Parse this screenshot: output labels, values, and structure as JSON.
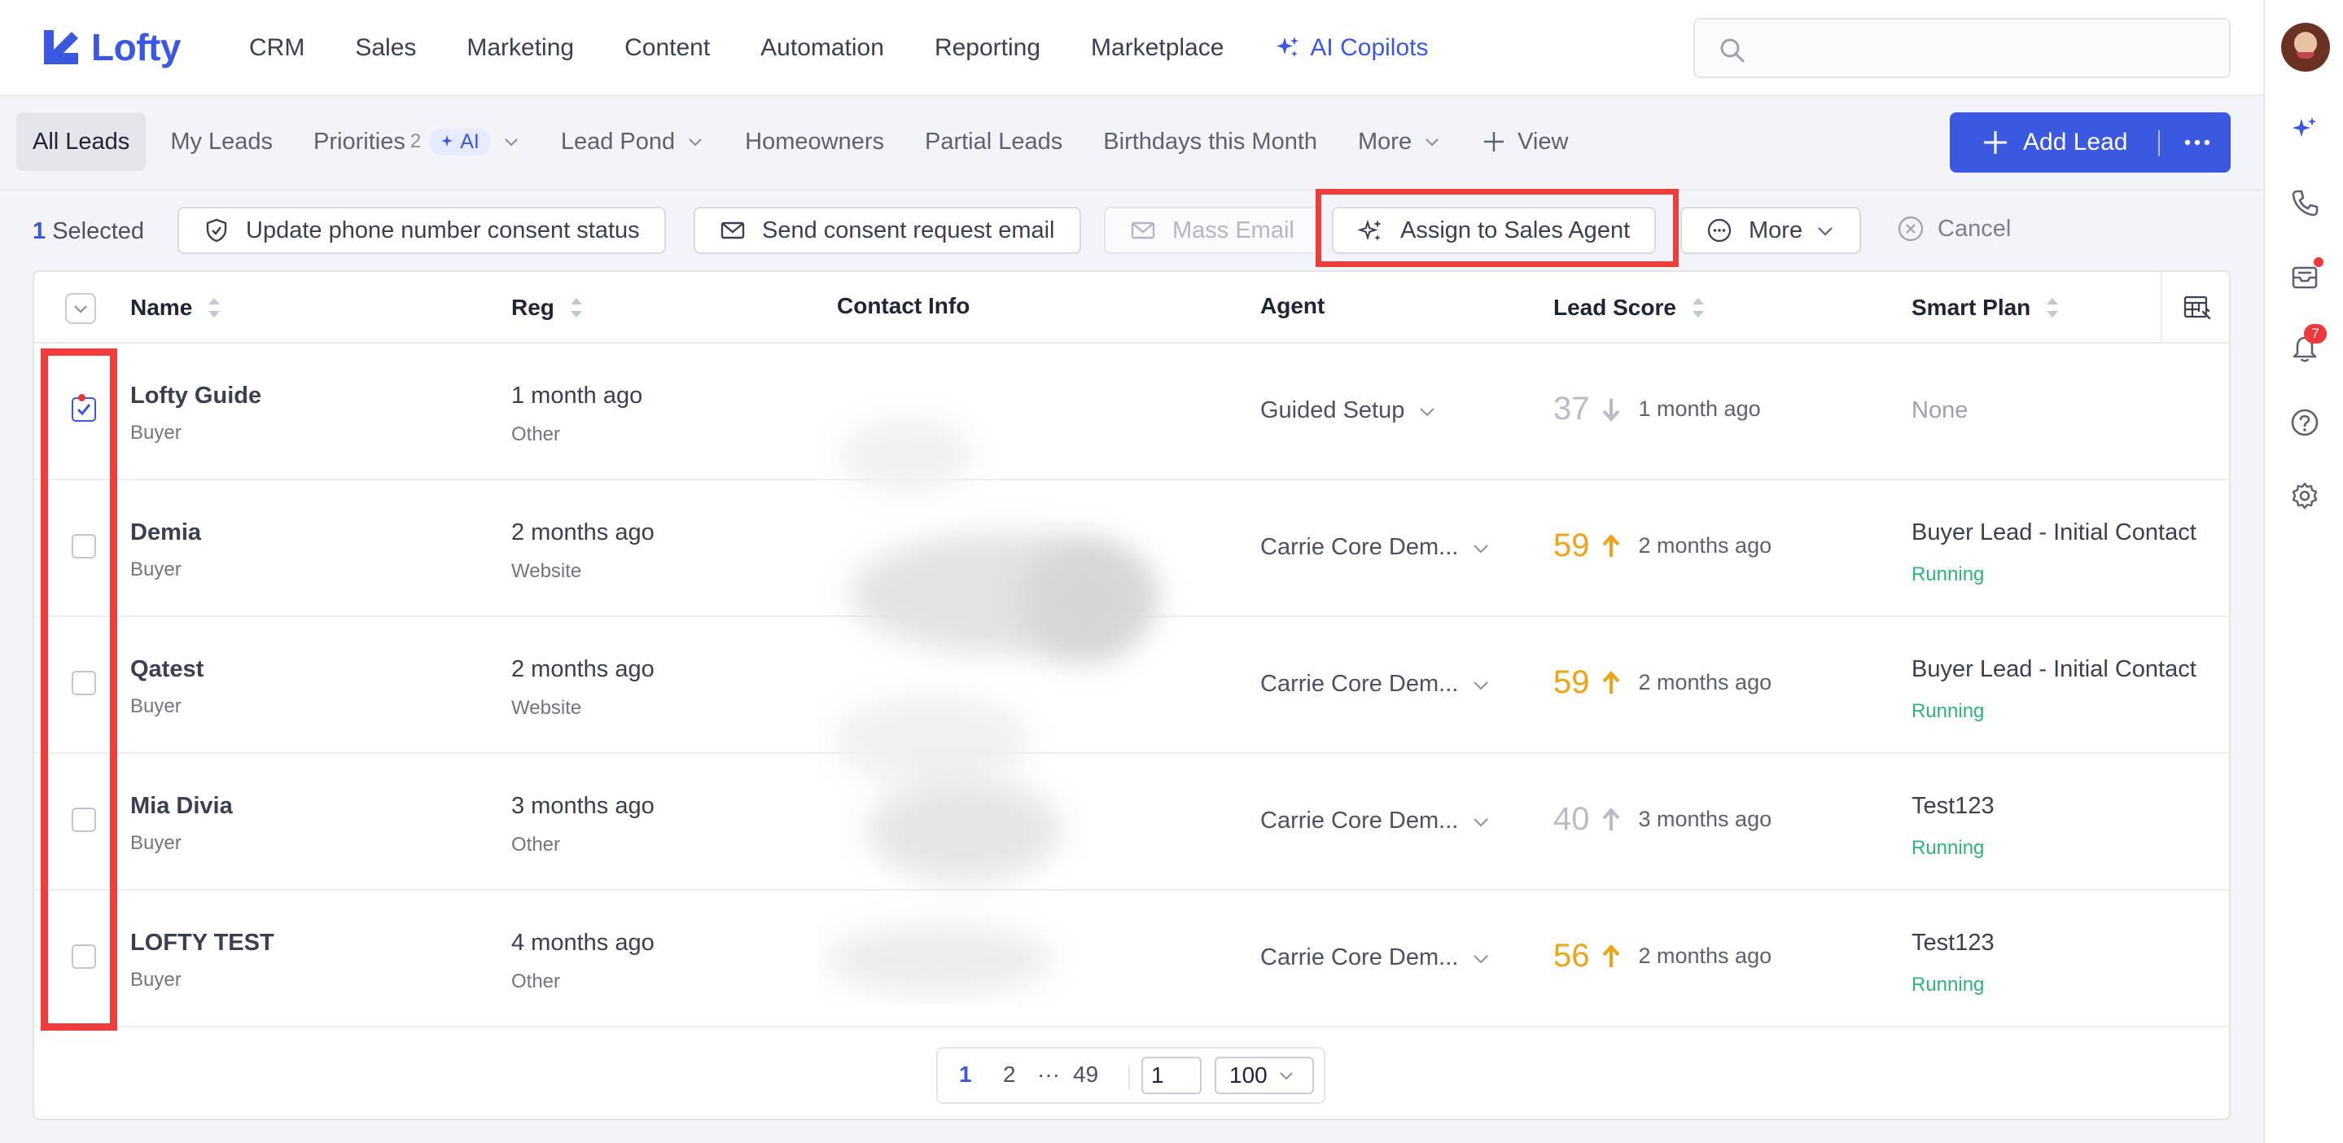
{
  "brand": {
    "name": "Lofty"
  },
  "nav": {
    "items": [
      "CRM",
      "Sales",
      "Marketing",
      "Content",
      "Automation",
      "Reporting",
      "Marketplace"
    ],
    "ai_copilots": "AI Copilots"
  },
  "search": {
    "placeholder": ""
  },
  "tabs": {
    "all_leads": "All Leads",
    "my_leads": "My Leads",
    "priorities": "Priorities",
    "priorities_count": "2",
    "ai_pill": "AI",
    "lead_pond": "Lead Pond",
    "homeowners": "Homeowners",
    "partial_leads": "Partial Leads",
    "birthdays": "Birthdays this Month",
    "more": "More",
    "view": "View"
  },
  "add_lead": {
    "label": "Add Lead"
  },
  "actions": {
    "selected_count": "1",
    "selected_label": "Selected",
    "update_consent": "Update phone number consent status",
    "send_consent": "Send consent request email",
    "mass_email": "Mass Email",
    "assign_agent": "Assign to Sales Agent",
    "more": "More",
    "cancel": "Cancel"
  },
  "table": {
    "headers": {
      "name": "Name",
      "reg": "Reg",
      "contact": "Contact Info",
      "agent": "Agent",
      "lead_score": "Lead Score",
      "smart_plan": "Smart Plan"
    },
    "rows": [
      {
        "name": "Lofty Guide",
        "type": "Buyer",
        "reg": "1 month ago",
        "source": "Other",
        "agent": "Guided Setup",
        "score": "37",
        "score_trend": "down",
        "score_color": "#b9bcc7",
        "score_when": "1 month ago",
        "plan": "None",
        "plan_status": "",
        "checked": true
      },
      {
        "name": "Demia",
        "type": "Buyer",
        "reg": "2 months ago",
        "source": "Website",
        "agent": "Carrie Core Dem...",
        "score": "59",
        "score_trend": "up",
        "score_color": "#f0a316",
        "score_when": "2 months ago",
        "plan": "Buyer Lead - Initial Contact",
        "plan_status": "Running",
        "checked": false
      },
      {
        "name": "Qatest",
        "type": "Buyer",
        "reg": "2 months ago",
        "source": "Website",
        "agent": "Carrie Core Dem...",
        "score": "59",
        "score_trend": "up",
        "score_color": "#f0a316",
        "score_when": "2 months ago",
        "plan": "Buyer Lead - Initial Contact",
        "plan_status": "Running",
        "checked": false
      },
      {
        "name": "Mia Divia",
        "type": "Buyer",
        "reg": "3 months ago",
        "source": "Other",
        "agent": "Carrie Core Dem...",
        "score": "40",
        "score_trend": "up",
        "score_color": "#b9bcc7",
        "score_when": "3 months ago",
        "plan": "Test123",
        "plan_status": "Running",
        "checked": false
      },
      {
        "name": "LOFTY TEST",
        "type": "Buyer",
        "reg": "4 months ago",
        "source": "Other",
        "agent": "Carrie Core Dem...",
        "score": "56",
        "score_trend": "up",
        "score_color": "#f0a316",
        "score_when": "2 months ago",
        "plan": "Test123",
        "plan_status": "Running",
        "checked": false
      }
    ]
  },
  "pagination": {
    "current": "1",
    "next": "2",
    "ellipsis": "···",
    "last": "49",
    "jump_value": "1",
    "page_size": "100"
  },
  "rail": {
    "notification_count": "7"
  },
  "colors": {
    "accent": "#3b58e0",
    "highlight": "#ef3d3b",
    "running": "#2bb673",
    "score_high": "#f0a316",
    "score_low": "#b9bcc7"
  }
}
